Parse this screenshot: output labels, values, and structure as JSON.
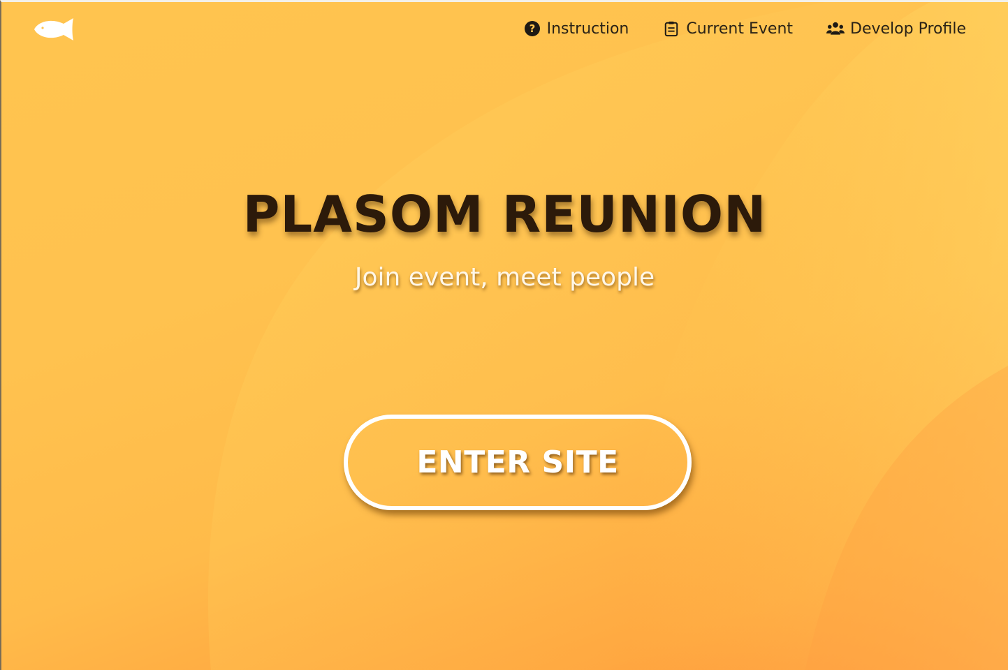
{
  "nav": {
    "logo_icon": "fish-icon",
    "items": [
      {
        "label": "Instruction",
        "icon": "question-circle-icon"
      },
      {
        "label": "Current Event",
        "icon": "clipboard-list-icon"
      },
      {
        "label": "Develop Profile",
        "icon": "users-icon"
      }
    ]
  },
  "hero": {
    "title": "PLASOM REUNION",
    "subtitle": "Join event, meet people",
    "button_label": "ENTER SITE"
  },
  "colors": {
    "background_top": "#ffc44f",
    "background_bottom": "#ff7b30",
    "title_text": "#2c1a0a",
    "button_border": "#ffffff"
  }
}
